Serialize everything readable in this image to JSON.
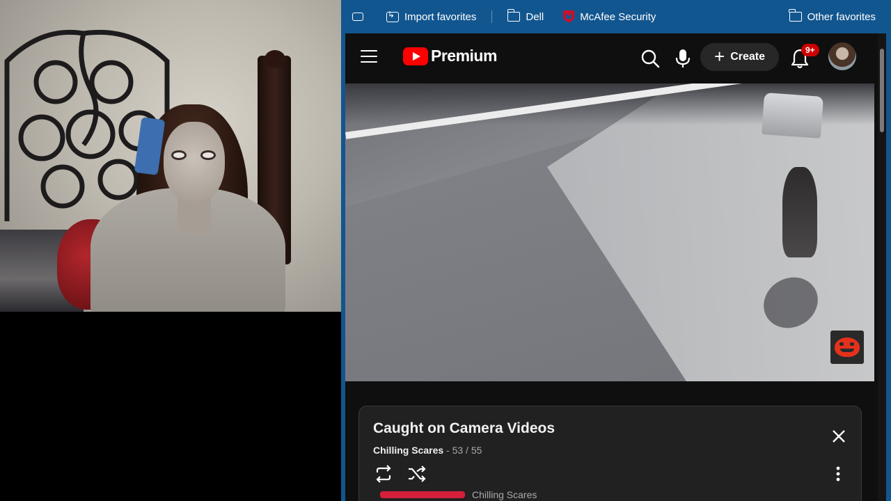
{
  "favorites_bar": {
    "items": [
      {
        "label": "Import favorites",
        "icon": "import-icon"
      },
      {
        "label": "Dell",
        "icon": "folder-icon"
      },
      {
        "label": "McAfee Security",
        "icon": "mcafee-icon"
      }
    ],
    "other_favorites": "Other favorites"
  },
  "youtube": {
    "logo_text": "Premium",
    "create_label": "Create",
    "notification_badge": "9+"
  },
  "playlist": {
    "title": "Caught on Camera Videos",
    "channel": "Chilling Scares",
    "position": "- 53 / 55",
    "next_item_channel": "Chilling Scares"
  },
  "colors": {
    "favbar_bg": "#12568f",
    "youtube_red": "#ff0000",
    "page_bg": "#0f0f0f"
  }
}
